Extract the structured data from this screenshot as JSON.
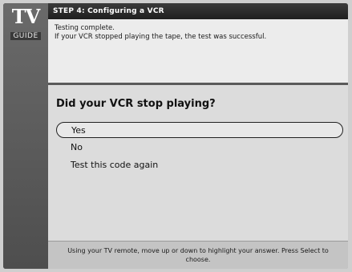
{
  "logo": {
    "line1": "TV",
    "line2": "GUIDE"
  },
  "header": {
    "title": "STEP 4: Configuring a VCR"
  },
  "status": {
    "line1": "Testing complete.",
    "line2": "If your VCR stopped playing the tape, the test was successful."
  },
  "question": {
    "text": "Did your VCR stop playing?"
  },
  "options": [
    {
      "label": "Yes",
      "selected": true
    },
    {
      "label": "No",
      "selected": false
    },
    {
      "label": "Test this code again",
      "selected": false
    }
  ],
  "footer": {
    "text": "Using your TV remote, move up or down to highlight your answer.  Press Select to choose."
  }
}
